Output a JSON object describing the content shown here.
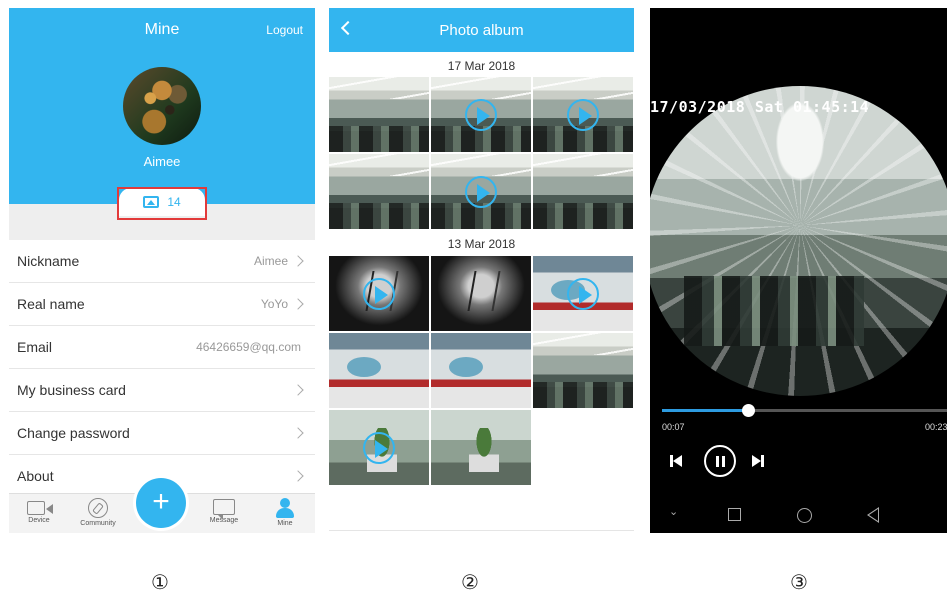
{
  "panel1": {
    "title": "Mine",
    "logout": "Logout",
    "user_name": "Aimee",
    "album_count": "14",
    "menu": [
      {
        "label": "Nickname",
        "value": "Aimee"
      },
      {
        "label": "Real name",
        "value": "YoYo"
      },
      {
        "label": "Email",
        "value": "46426659@qq.com"
      },
      {
        "label": "My business card",
        "value": ""
      },
      {
        "label": "Change password",
        "value": ""
      },
      {
        "label": "About",
        "value": ""
      }
    ],
    "tabs": [
      {
        "label": "Device",
        "icon": "video-camera-icon"
      },
      {
        "label": "Community",
        "icon": "compass-icon"
      },
      {
        "label": "Message",
        "icon": "chat-bubble-icon"
      },
      {
        "label": "Mine",
        "icon": "person-icon"
      }
    ],
    "fab": "+",
    "accent_color": "#33b5ef",
    "highlight_color": "#e23a3a"
  },
  "panel2": {
    "title": "Photo album",
    "groups": [
      {
        "date": "17 Mar 2018"
      },
      {
        "date": "13 Mar 2018"
      }
    ]
  },
  "panel3": {
    "osd_timestamp": "17/03/2018 Sat 01:45:14",
    "elapsed": "00:07",
    "total": "00:23",
    "progress_fraction": 0.3
  },
  "labels": {
    "one": "①",
    "two": "②",
    "three": "③"
  }
}
